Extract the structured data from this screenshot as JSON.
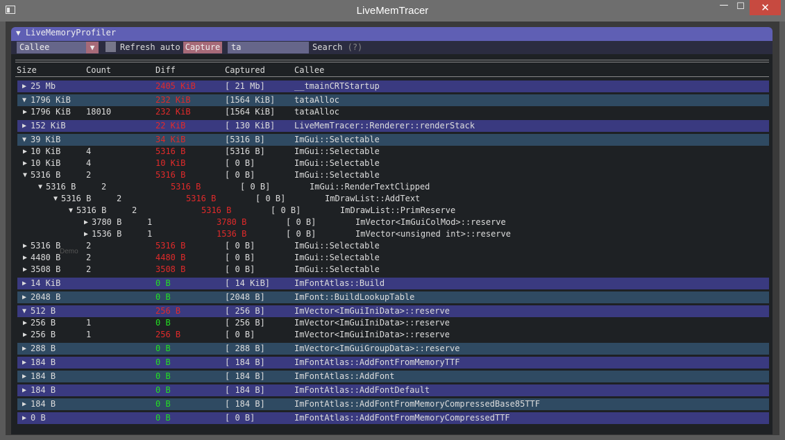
{
  "window": {
    "title": "LiveMemTracer",
    "minimize": "—",
    "maximize": "☐",
    "close": "✕"
  },
  "panel": {
    "title": "LiveMemoryProfiler",
    "collapse_icon": "▼"
  },
  "toolbar": {
    "combo_value": "Callee",
    "combo_arrow": "▼",
    "refresh_label": "Refresh auto",
    "capture_label": "Capture",
    "search_value": "ta",
    "search_label": "Search",
    "help_label": "(?)"
  },
  "columns": [
    "Size",
    "Count",
    "Diff",
    "Captured",
    "Callee"
  ],
  "ghost_text": "Demo",
  "rows": [
    {
      "tri": "▶",
      "size": "25 Mb",
      "count": "",
      "diff": "2405 KiB",
      "diff_color": "red",
      "captured": "[  21 Mb]",
      "callee": "__tmainCRTStartup",
      "style": "a"
    },
    {
      "tri": "▼",
      "size": "1796 KiB",
      "count": "",
      "diff": "232 KiB",
      "diff_color": "red",
      "captured": "[1564 KiB]",
      "callee": "tataAlloc",
      "style": "b"
    },
    {
      "tri": "▶",
      "size": "1796 KiB",
      "count": "18010",
      "diff": "232 KiB",
      "diff_color": "red",
      "captured": "[1564 KiB]",
      "callee": "tataAlloc",
      "style": ""
    },
    {
      "tri": "▶",
      "size": "152 KiB",
      "count": "",
      "diff": "22 KiB",
      "diff_color": "red",
      "captured": "[ 130 KiB]",
      "callee": "LiveMemTracer::Renderer::renderStack",
      "style": "a"
    },
    {
      "tri": "▼",
      "size": "39 KiB",
      "count": "",
      "diff": "34 KiB",
      "diff_color": "red",
      "captured": "[5316 B]",
      "callee": "ImGui::Selectable",
      "style": "b"
    },
    {
      "tri": "▶",
      "size": "10 KiB",
      "count": "4",
      "diff": "5316 B",
      "diff_color": "red",
      "captured": "[5316 B]",
      "callee": "ImGui::Selectable",
      "style": ""
    },
    {
      "tri": "▶",
      "size": "10 KiB",
      "count": "4",
      "diff": "10 KiB",
      "diff_color": "red",
      "captured": "[   0 B]",
      "callee": "ImGui::Selectable",
      "style": ""
    },
    {
      "tri": "▼",
      "size": "5316 B",
      "count": "2",
      "diff": "5316 B",
      "diff_color": "red",
      "captured": "[   0 B]",
      "callee": "ImGui::Selectable",
      "style": ""
    },
    {
      "tri": "▼",
      "size": "5316 B",
      "count": "2",
      "diff": "5316 B",
      "diff_color": "red",
      "captured": "[   0 B]",
      "callee": "ImGui::RenderTextClipped",
      "style": ""
    },
    {
      "tri": "▼",
      "size": "5316 B",
      "count": "2",
      "diff": "5316 B",
      "diff_color": "red",
      "captured": "[   0 B]",
      "callee": "ImDrawList::AddText",
      "style": ""
    },
    {
      "tri": "▼",
      "size": "5316 B",
      "count": "2",
      "diff": "5316 B",
      "diff_color": "red",
      "captured": "[   0 B]",
      "callee": "ImDrawList::PrimReserve",
      "style": ""
    },
    {
      "tri": "▶",
      "size": "3780 B",
      "count": "1",
      "diff": "3780 B",
      "diff_color": "red",
      "captured": "[   0 B]",
      "callee": "ImVector<ImGuiColMod>::reserve",
      "style": ""
    },
    {
      "tri": "▶",
      "size": "1536 B",
      "count": "1",
      "diff": "1536 B",
      "diff_color": "red",
      "captured": "[   0 B]",
      "callee": "ImVector<unsigned int>::reserve",
      "style": ""
    },
    {
      "tri": "▶",
      "size": "5316 B",
      "count": "2",
      "diff": "5316 B",
      "diff_color": "red",
      "captured": "[   0 B]",
      "callee": "ImGui::Selectable",
      "style": ""
    },
    {
      "tri": "▶",
      "size": "4480 B",
      "count": "2",
      "diff": "4480 B",
      "diff_color": "red",
      "captured": "[   0 B]",
      "callee": "ImGui::Selectable",
      "style": ""
    },
    {
      "tri": "▶",
      "size": "3508 B",
      "count": "2",
      "diff": "3508 B",
      "diff_color": "red",
      "captured": "[   0 B]",
      "callee": "ImGui::Selectable",
      "style": ""
    },
    {
      "tri": "▶",
      "size": "14 KiB",
      "count": "",
      "diff": "0 B",
      "diff_color": "green",
      "captured": "[  14 KiB]",
      "callee": "ImFontAtlas::Build",
      "style": "a"
    },
    {
      "tri": "▶",
      "size": "2048 B",
      "count": "",
      "diff": "0 B",
      "diff_color": "green",
      "captured": "[2048 B]",
      "callee": "ImFont::BuildLookupTable",
      "style": "b"
    },
    {
      "tri": "▼",
      "size": "512 B",
      "count": "",
      "diff": "256 B",
      "diff_color": "red",
      "captured": "[ 256 B]",
      "callee": "ImVector<ImGuiIniData>::reserve",
      "style": "a"
    },
    {
      "tri": "▶",
      "size": "256 B",
      "count": "1",
      "diff": "0 B",
      "diff_color": "green",
      "captured": "[ 256 B]",
      "callee": "ImVector<ImGuiIniData>::reserve",
      "style": ""
    },
    {
      "tri": "▶",
      "size": "256 B",
      "count": "1",
      "diff": "256 B",
      "diff_color": "red",
      "captured": "[   0 B]",
      "callee": "ImVector<ImGuiIniData>::reserve",
      "style": ""
    },
    {
      "tri": "▶",
      "size": "288 B",
      "count": "",
      "diff": "0 B",
      "diff_color": "green",
      "captured": "[ 288 B]",
      "callee": "ImVector<ImGuiGroupData>::reserve",
      "style": "b"
    },
    {
      "tri": "▶",
      "size": "184 B",
      "count": "",
      "diff": "0 B",
      "diff_color": "green",
      "captured": "[ 184 B]",
      "callee": "ImFontAtlas::AddFontFromMemoryTTF",
      "style": "a"
    },
    {
      "tri": "▶",
      "size": "184 B",
      "count": "",
      "diff": "0 B",
      "diff_color": "green",
      "captured": "[ 184 B]",
      "callee": "ImFontAtlas::AddFont",
      "style": "b"
    },
    {
      "tri": "▶",
      "size": "184 B",
      "count": "",
      "diff": "0 B",
      "diff_color": "green",
      "captured": "[ 184 B]",
      "callee": "ImFontAtlas::AddFontDefault",
      "style": "a"
    },
    {
      "tri": "▶",
      "size": "184 B",
      "count": "",
      "diff": "0 B",
      "diff_color": "green",
      "captured": "[ 184 B]",
      "callee": "ImFontAtlas::AddFontFromMemoryCompressedBase85TTF",
      "style": "b"
    },
    {
      "tri": "▶",
      "size": "0 B",
      "count": "",
      "diff": "0 B",
      "diff_color": "green",
      "captured": "[   0 B]",
      "callee": "ImFontAtlas::AddFontFromMemoryCompressedTTF",
      "style": "a"
    }
  ]
}
